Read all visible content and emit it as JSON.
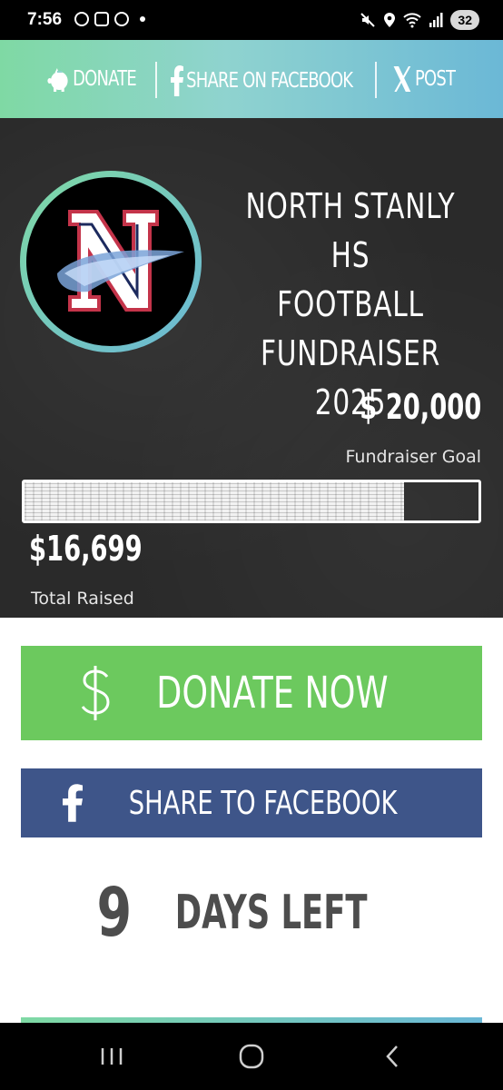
{
  "status_bar": {
    "time": "7:56",
    "battery": "32",
    "left_icons": [
      "messenger-icon",
      "instagram-icon",
      "messenger-icon",
      "dot"
    ],
    "right_icons": [
      "mute-icon",
      "location-icon",
      "wifi-icon",
      "signal-icon",
      "battery-icon"
    ]
  },
  "share_header": {
    "donate_label": "DONATE",
    "facebook_label": "SHARE ON FACEBOOK",
    "x_label": "POST"
  },
  "hero": {
    "title_line1": "NORTH STANLY HS",
    "title_line2": "FOOTBALL",
    "title_line3": "FUNDRAISER 2025",
    "goal_amount": "$ 20,000",
    "goal_label": "Fundraiser Goal",
    "raised_amount": "$16,699",
    "raised_label": "Total Raised",
    "progress_fraction": 0.835
  },
  "buttons": {
    "donate_now": "DONATE NOW",
    "share_facebook": "SHARE TO FACEBOOK"
  },
  "countdown": {
    "days": "9",
    "label": "DAYS LEFT"
  },
  "colors": {
    "accent_green": "#6cc95e",
    "facebook_blue": "#3e5589",
    "chalkboard": "#2a2a2a",
    "gradient_start": "#7fd9a4",
    "gradient_end": "#6bb8d6"
  }
}
